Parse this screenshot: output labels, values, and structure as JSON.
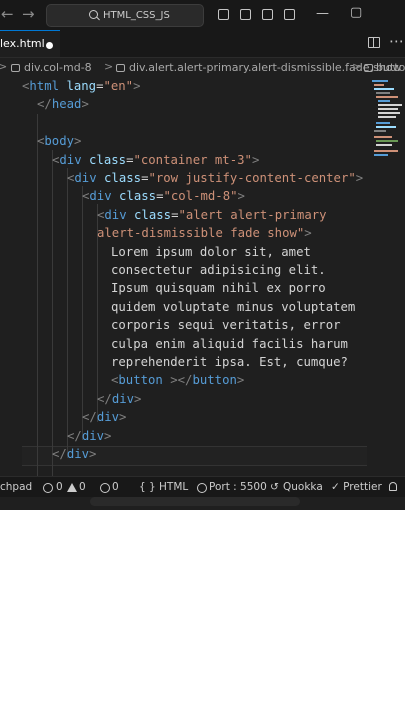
{
  "titlebar": {
    "search_text": "HTML_CSS_JS",
    "back_arrow": "←",
    "forward_arrow": "→",
    "minimize": "—",
    "maximize": "▢"
  },
  "tabs": [
    {
      "label": "lex.html"
    }
  ],
  "tab_more": "⋯",
  "breadcrumbs": [
    {
      "label": "div.col-md-8"
    },
    {
      "label": "div.alert.alert-primary.alert-dismissible.fade.show"
    },
    {
      "label": "butto"
    }
  ],
  "breadcrumb_sep": ">",
  "code_lines": [
    [
      {
        "t": "<",
        "c": "punct"
      },
      {
        "t": "html",
        "c": "tag"
      },
      {
        "t": " ",
        "c": "text"
      },
      {
        "t": "lang",
        "c": "attr"
      },
      {
        "t": "=",
        "c": "eq"
      },
      {
        "t": "\"en\"",
        "c": "str"
      },
      {
        "t": ">",
        "c": "punct"
      }
    ],
    [
      {
        "t": "</",
        "c": "punct"
      },
      {
        "t": "head",
        "c": "tag"
      },
      {
        "t": ">",
        "c": "punct"
      }
    ],
    [],
    [
      {
        "t": "<",
        "c": "punct"
      },
      {
        "t": "body",
        "c": "tag"
      },
      {
        "t": ">",
        "c": "punct"
      }
    ],
    [
      {
        "t": "<",
        "c": "punct"
      },
      {
        "t": "div",
        "c": "tag"
      },
      {
        "t": " ",
        "c": "text"
      },
      {
        "t": "class",
        "c": "attr"
      },
      {
        "t": "=",
        "c": "eq"
      },
      {
        "t": "\"container mt-3\"",
        "c": "str"
      },
      {
        "t": ">",
        "c": "punct"
      }
    ],
    [
      {
        "t": "<",
        "c": "punct"
      },
      {
        "t": "div",
        "c": "tag"
      },
      {
        "t": " ",
        "c": "text"
      },
      {
        "t": "class",
        "c": "attr"
      },
      {
        "t": "=",
        "c": "eq"
      },
      {
        "t": "\"row justify-content-center\"",
        "c": "str"
      },
      {
        "t": ">",
        "c": "punct"
      }
    ],
    [
      {
        "t": "<",
        "c": "punct"
      },
      {
        "t": "div",
        "c": "tag"
      },
      {
        "t": " ",
        "c": "text"
      },
      {
        "t": "class",
        "c": "attr"
      },
      {
        "t": "=",
        "c": "eq"
      },
      {
        "t": "\"col-md-8\"",
        "c": "str"
      },
      {
        "t": ">",
        "c": "punct"
      }
    ],
    [
      {
        "t": "<",
        "c": "punct"
      },
      {
        "t": "div",
        "c": "tag"
      },
      {
        "t": " ",
        "c": "text"
      },
      {
        "t": "class",
        "c": "attr"
      },
      {
        "t": "=",
        "c": "eq"
      },
      {
        "t": "\"alert alert-primary",
        "c": "str"
      }
    ],
    [
      {
        "t": "alert-dismissible fade show\"",
        "c": "str"
      },
      {
        "t": ">",
        "c": "punct"
      }
    ],
    [
      {
        "t": "Lorem ipsum dolor sit, amet",
        "c": "text"
      }
    ],
    [
      {
        "t": "consectetur adipisicing elit.",
        "c": "text"
      }
    ],
    [
      {
        "t": "Ipsum quisquam nihil ex porro",
        "c": "text"
      }
    ],
    [
      {
        "t": "quidem voluptate minus voluptatem",
        "c": "text"
      }
    ],
    [
      {
        "t": "corporis sequi veritatis, error",
        "c": "text"
      }
    ],
    [
      {
        "t": "culpa enim aliquid facilis harum",
        "c": "text"
      }
    ],
    [
      {
        "t": "reprehenderit ipsa. Est, cumque?",
        "c": "text"
      }
    ],
    [
      {
        "t": "<",
        "c": "punct"
      },
      {
        "t": "button",
        "c": "tag"
      },
      {
        "t": " ",
        "c": "text"
      },
      {
        "t": ">",
        "c": "punct"
      },
      {
        "t": "</",
        "c": "punct"
      },
      {
        "t": "button",
        "c": "tag"
      },
      {
        "t": ">",
        "c": "punct"
      }
    ],
    [
      {
        "t": "</",
        "c": "punct"
      },
      {
        "t": "div",
        "c": "tag"
      },
      {
        "t": ">",
        "c": "punct"
      }
    ],
    [
      {
        "t": "</",
        "c": "punct"
      },
      {
        "t": "div",
        "c": "tag"
      },
      {
        "t": ">",
        "c": "punct"
      }
    ],
    [
      {
        "t": "</",
        "c": "punct"
      },
      {
        "t": "div",
        "c": "tag"
      },
      {
        "t": ">",
        "c": "punct"
      }
    ],
    [
      {
        "t": "</",
        "c": "punct"
      },
      {
        "t": "div",
        "c": "tag"
      },
      {
        "t": ">",
        "c": "punct"
      }
    ]
  ],
  "code_colors": {
    "tag": "#569cd6",
    "attr": "#9cdcfe",
    "str": "#ce9178",
    "punct": "#808080",
    "text": "#d4d4d4"
  },
  "statusbar": {
    "left_label": "chpad",
    "errors": "0",
    "warnings": "0",
    "info": "0",
    "language": "{ } HTML",
    "port": "Port : 5500",
    "quokka": "Quokka",
    "prettier": "✓ Prettier"
  }
}
